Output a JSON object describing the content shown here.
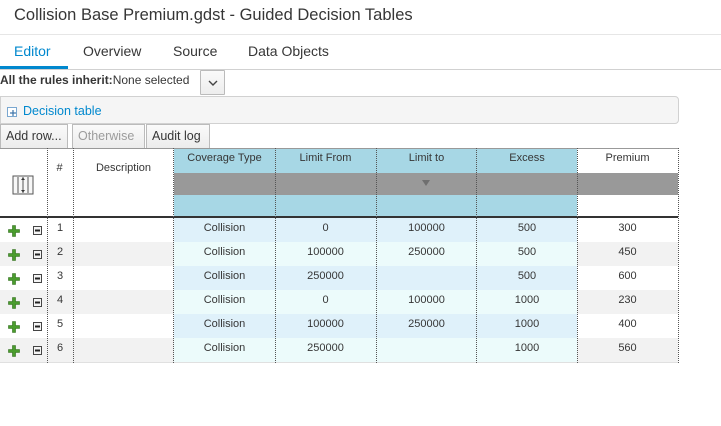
{
  "window": {
    "title": "Collision Base Premium.gdst - Guided Decision Tables"
  },
  "tabs": [
    {
      "label": "Editor",
      "active": true
    },
    {
      "label": "Overview",
      "active": false
    },
    {
      "label": "Source",
      "active": false
    },
    {
      "label": "Data Objects",
      "active": false
    }
  ],
  "inherit": {
    "label": "All the rules inherit:",
    "value": "None selected"
  },
  "decision_table": {
    "label": "Decision table"
  },
  "toolbar": {
    "add_row": "Add row...",
    "otherwise": "Otherwise",
    "audit_log": "Audit log"
  },
  "table": {
    "headers": {
      "num": "#",
      "description": "Description",
      "coverage_type": "Coverage Type",
      "limit_from": "Limit From",
      "limit_to": "Limit to",
      "excess": "Excess",
      "premium": "Premium"
    },
    "rows": [
      {
        "num": "1",
        "description": "",
        "coverage_type": "Collision",
        "limit_from": "0",
        "limit_to": "100000",
        "excess": "500",
        "premium": "300"
      },
      {
        "num": "2",
        "description": "",
        "coverage_type": "Collision",
        "limit_from": "100000",
        "limit_to": "250000",
        "excess": "500",
        "premium": "450"
      },
      {
        "num": "3",
        "description": "",
        "coverage_type": "Collision",
        "limit_from": "250000",
        "limit_to": "",
        "excess": "500",
        "premium": "600"
      },
      {
        "num": "4",
        "description": "",
        "coverage_type": "Collision",
        "limit_from": "0",
        "limit_to": "100000",
        "excess": "1000",
        "premium": "230"
      },
      {
        "num": "5",
        "description": "",
        "coverage_type": "Collision",
        "limit_from": "100000",
        "limit_to": "250000",
        "excess": "1000",
        "premium": "400"
      },
      {
        "num": "6",
        "description": "",
        "coverage_type": "Collision",
        "limit_from": "250000",
        "limit_to": "",
        "excess": "1000",
        "premium": "560"
      }
    ]
  },
  "icons": {
    "add_row": "plus-icon",
    "delete_row": "minus-icon",
    "column_toggle": "column-toggle-icon",
    "pattern_collapse": "triangle-down-icon",
    "dropdown": "chevron-down-icon"
  },
  "colors": {
    "accent": "#0088ce",
    "condition_header": "#a7d7e5",
    "pattern_bar": "#999999",
    "row_alt": "#f2f2f2",
    "condition_cell": "#dff1fa",
    "condition_cell_alt": "#ecfbfb",
    "plus_green": "#4a9c2d"
  }
}
